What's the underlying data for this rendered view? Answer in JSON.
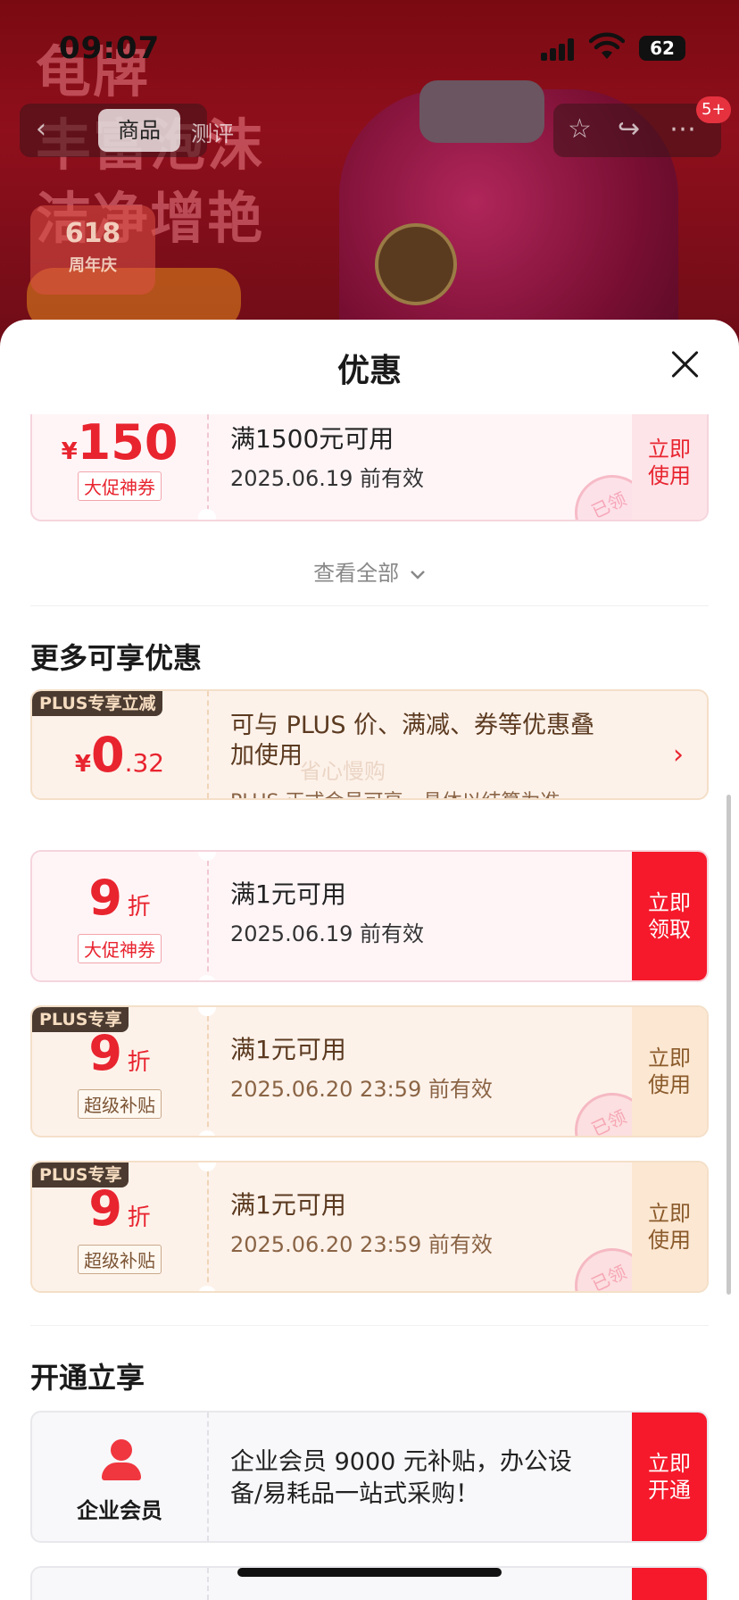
{
  "status_bar": {
    "time": "09:07",
    "battery": "62"
  },
  "banner": {
    "promo_lines": [
      "龟牌",
      "丰富泡沫",
      "洁净增艳"
    ],
    "badge_618": "618",
    "badge_618_sub": "周年庆",
    "nav_back": "‹",
    "tab_goods": "商品",
    "tab_review": "测评",
    "cart_badge": "5+",
    "icons": [
      "back-icon",
      "star-icon",
      "share-icon",
      "more-icon"
    ]
  },
  "sheet": {
    "title": "优惠",
    "top_coupon": {
      "currency": "¥",
      "amount": "150",
      "tag": "大促神券",
      "condition": "满1500元可用",
      "validity": "2025.06.19 前有效",
      "action": "立即使用",
      "stamp": "已领"
    },
    "view_all": "查看全部",
    "more_section_title": "更多可享优惠",
    "plus_card": {
      "label": "PLUS专享立减",
      "currency": "¥",
      "amount_int": "0",
      "amount_dec": ".32",
      "description": "可与 PLUS 价、满减、券等优惠叠加使用",
      "sub": "PLUS 正式会员可享，具体以结算为准",
      "watermark": "省心慢购"
    },
    "coupons": [
      {
        "plus_label": "",
        "discount": "9",
        "unit": "折",
        "tag": "大促神券",
        "condition": "满1元可用",
        "validity": "2025.06.19 前有效",
        "action": "立即领取",
        "stamp": ""
      },
      {
        "plus_label": "PLUS专享",
        "discount": "9",
        "unit": "折",
        "tag": "超级补贴",
        "condition": "满1元可用",
        "validity": "2025.06.20 23:59 前有效",
        "action": "立即使用",
        "stamp": "已领"
      },
      {
        "plus_label": "PLUS专享",
        "discount": "9",
        "unit": "折",
        "tag": "超级补贴",
        "condition": "满1元可用",
        "validity": "2025.06.20 23:59 前有效",
        "action": "立即使用",
        "stamp": "已领"
      }
    ],
    "open_section_title": "开通立享",
    "enterprise": {
      "name": "企业会员",
      "description": "企业会员 9000 元补贴，办公设备/易耗品一站式采购！",
      "action": "立即开通"
    }
  },
  "colors": {
    "accent_red": "#f5192b",
    "plus_brown": "#4a3a30",
    "plus_bg": "#fdf2ea",
    "coupon_bg": "#fff5f7"
  }
}
